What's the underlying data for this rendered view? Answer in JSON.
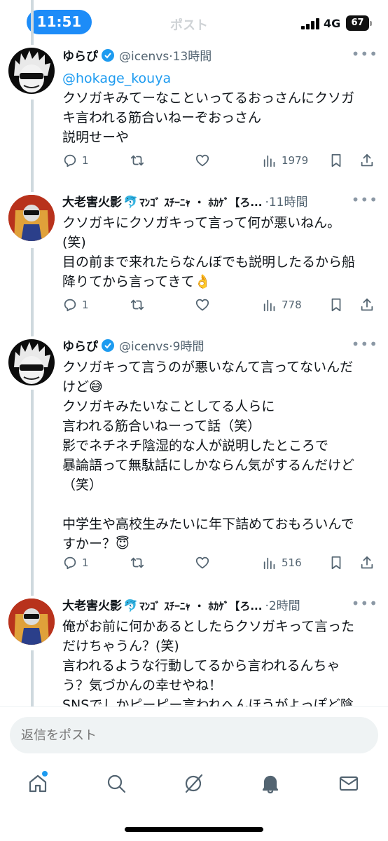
{
  "status_bar": {
    "time": "11:51",
    "network": "4G",
    "battery": "67",
    "header_faded": "ポスト"
  },
  "tweets": [
    {
      "name": "ゆらぴ",
      "handle": "@icenvs",
      "sep": "·",
      "time_ago": "13時間",
      "mention": "@hokage_kouya",
      "text": "クソガキみてーなこといってるおっさんにクソガ\nキ言われる筋合いねーぞおっさん\n説明せーや",
      "replies": "1",
      "views": "1979"
    },
    {
      "name": "大老害火影",
      "name_suffix": "ﾏﾝｺﾞ ｽﾁｰﾆｬ ・ ﾎｶｹﾞ【ろ...",
      "dolphin": "🐬",
      "handle": "",
      "sep": "·",
      "time_ago": "11時間",
      "text": "クソガキにクソガキって言って何が悪いねん。\n(笑)\n目の前まで来れたらなんぼでも説明したるから船\n降りてから言ってきて👌",
      "replies": "1",
      "views": "778"
    },
    {
      "name": "ゆらぴ",
      "handle": "@icenvs",
      "sep": "·",
      "time_ago": "9時間",
      "text": "クソガキって言うのが悪いなんて言ってないんだ\nけど😅\nクソガキみたいなことしてる人らに\n言われる筋合いねーって話（笑）\n影でネチネチ陰湿的な人が説明したところで\n暴論語って無駄話にしかならん気がするんだけど\n（笑）\n\n中学生や高校生みたいに年下詰めておもろいんで\nすかー？😇",
      "replies": "1",
      "views": "516"
    },
    {
      "name": "大老害火影",
      "name_suffix": "ﾏﾝｺﾞ ｽﾁｰﾆｬ ・ ﾎｶｹﾞ【ろ...",
      "dolphin": "🐬",
      "handle": "",
      "sep": "·",
      "time_ago": "2時間",
      "text": "俺がお前に何かあるとしたらクソガキって言った\nだけちゃうん？(笑)\n言われるような行動してるから言われるんちゃ\nう？気づかんの幸せやね！\nSNSでしかピーピー言われへんほうがよっぽど陰"
    }
  ],
  "reply_bar": {
    "placeholder": "返信をポスト"
  },
  "tab_bar": {
    "icons": [
      "home-icon",
      "search-icon",
      "grok-icon",
      "bell-icon",
      "mail-icon"
    ]
  },
  "colors": {
    "accent": "#1d9bf0",
    "time_pill": "#1d8cf8",
    "muted": "#536471",
    "thread_line": "#cfd9de"
  }
}
